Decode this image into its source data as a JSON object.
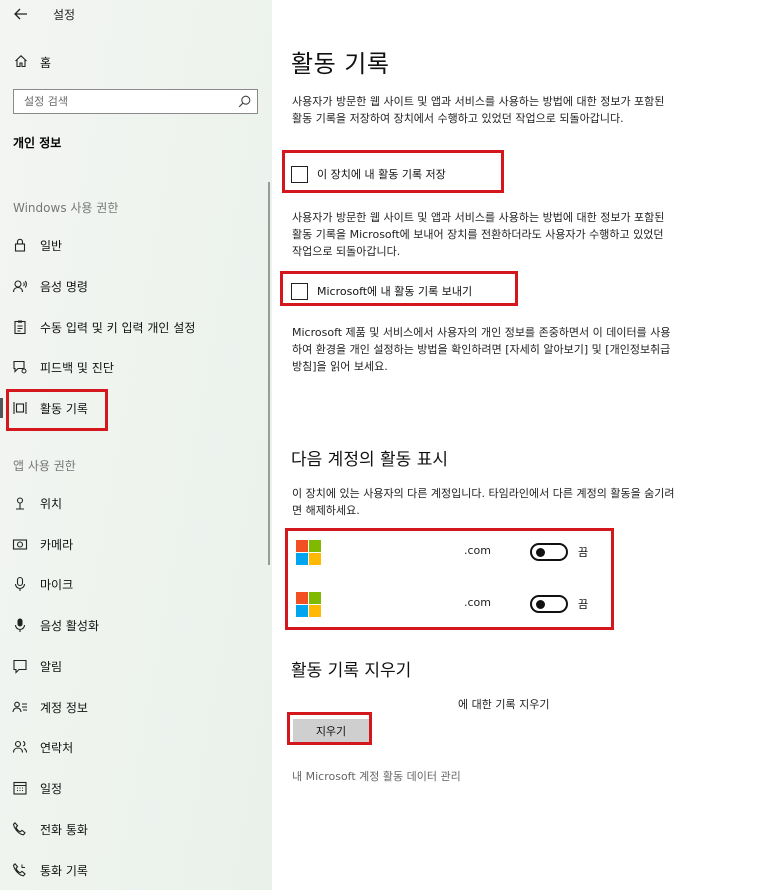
{
  "window": {
    "title": "설정",
    "back_icon": "back-arrow-icon"
  },
  "sidebar": {
    "home_label": "홈",
    "search_placeholder": "설정 검색",
    "section_title": "개인 정보",
    "group_windows": "Windows 사용 권한",
    "group_app": "앱 사용 권한",
    "items_windows": [
      {
        "label": "일반",
        "icon": "lock-icon"
      },
      {
        "label": "음성 명령",
        "icon": "speech-icon"
      },
      {
        "label": "수동 입력 및 키 입력 개인 설정",
        "icon": "clipboard-icon"
      },
      {
        "label": "피드백 및 진단",
        "icon": "feedback-icon"
      },
      {
        "label": "활동 기록",
        "icon": "timeline-icon",
        "active": true
      }
    ],
    "items_app": [
      {
        "label": "위치",
        "icon": "location-icon"
      },
      {
        "label": "카메라",
        "icon": "camera-icon"
      },
      {
        "label": "마이크",
        "icon": "microphone-icon"
      },
      {
        "label": "음성 활성화",
        "icon": "voice-activation-icon"
      },
      {
        "label": "알림",
        "icon": "notification-icon"
      },
      {
        "label": "계정 정보",
        "icon": "account-info-icon"
      },
      {
        "label": "연락처",
        "icon": "contacts-icon"
      },
      {
        "label": "일정",
        "icon": "calendar-icon"
      },
      {
        "label": "전화 통화",
        "icon": "phone-icon"
      },
      {
        "label": "통화 기록",
        "icon": "call-history-icon"
      }
    ]
  },
  "main": {
    "title": "활동 기록",
    "para1": "사용자가 방문한 웹 사이트 및 앱과 서비스를 사용하는 방법에 대한 정보가 포함된 활동 기록을 저장하여 장치에서 수행하고 있었던 작업으로 되돌아갑니다.",
    "checkbox1_label": "이 장치에 내 활동 기록 저장",
    "para2": "사용자가 방문한 웹 사이트 및 앱과 서비스를 사용하는 방법에 대한 정보가 포함된 활동 기록을 Microsoft에 보내어 장치를 전환하더라도 사용자가 수행하고 있었던 작업으로 되돌아갑니다.",
    "checkbox2_label": "Microsoft에 내 활동 기록 보내기",
    "para3": "Microsoft 제품 및 서비스에서 사용자의 개인 정보를 존중하면서 이 데이터를 사용하여 환경을 개인 설정하는 방법을 확인하려면 [자세히 알아보기] 및 [개인정보취급방침]을 읽어 보세요.",
    "accounts_title": "다음 계정의 활동 표시",
    "accounts_desc": "이 장치에 있는 사용자의 다른 계정입니다. 타임라인에서 다른 계정의 활동을 숨기려면 해제하세요.",
    "accounts": [
      {
        "email": ".com",
        "toggle_label": "끔",
        "on": false
      },
      {
        "email": ".com",
        "toggle_label": "끔",
        "on": false
      }
    ],
    "clear_title": "활동 기록 지우기",
    "clear_desc": "에 대한 기록 지우기",
    "clear_button": "지우기",
    "manage_link": "내 Microsoft 계정 활동 데이터 관리"
  },
  "colors": {
    "highlight_red": "#d4161d",
    "ms_red": "#f25022",
    "ms_green": "#7fba00",
    "ms_blue": "#00a4ef",
    "ms_yellow": "#ffb900"
  }
}
